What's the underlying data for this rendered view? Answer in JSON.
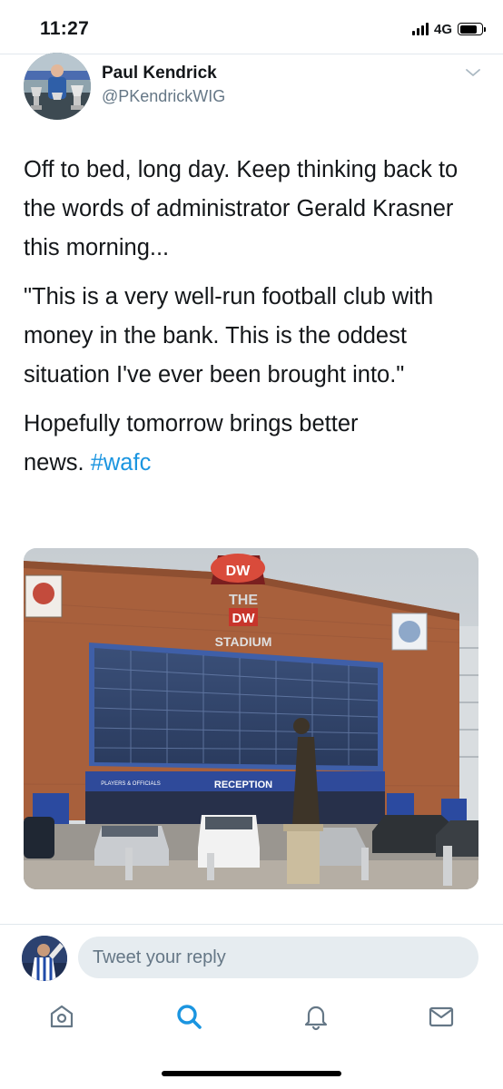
{
  "status_bar": {
    "time": "11:27",
    "network": "4G",
    "battery_level": 0.85
  },
  "tweet": {
    "author": {
      "name": "Paul Kendrick",
      "handle": "@PKendrickWIG"
    },
    "paragraphs": [
      "Off to bed, long day. Keep thinking back to the words of administrator Gerald Krasner this morning...",
      "\"This is a very well-run football club with money in the bank. This is the oddest situation I've ever been brought into.\"",
      "Hopefully tomorrow brings better"
    ],
    "last_line_prefix": "news. ",
    "hashtag": "#wafc",
    "media": {
      "sign_the": "THE",
      "sign_dw": "DW",
      "sign_stadium": "STADIUM",
      "sign_reception": "RECEPTION",
      "sign_players": "PLAYERS & OFFICIALS"
    }
  },
  "reply": {
    "placeholder": "Tweet your reply"
  },
  "colors": {
    "accent": "#1b95e0",
    "secondary_text": "#657786",
    "input_bg": "#e6ecf0"
  },
  "tabs": [
    {
      "icon": "home-icon"
    },
    {
      "icon": "search-icon",
      "active": true
    },
    {
      "icon": "bell-icon"
    },
    {
      "icon": "mail-icon"
    }
  ]
}
